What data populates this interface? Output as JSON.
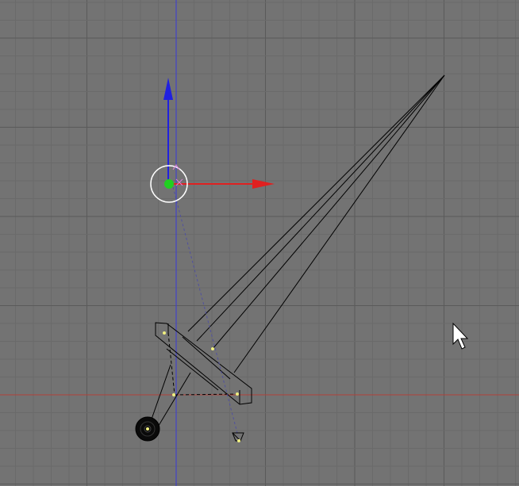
{
  "viewport": {
    "background_color": "#737373",
    "grid_minor_color": "#6a6a6a",
    "grid_major_color": "#5a5a5a",
    "axis_x_color": "#b0403a",
    "axis_z_color": "#3a3ad8",
    "wire_color": "#000000",
    "vertex_color": "#f0f080"
  },
  "gizmo": {
    "x_arrow_color": "#e02020",
    "z_arrow_color": "#2020e0",
    "center_color": "#20d020",
    "ring_color": "#ffffff",
    "marker_color": "#e080e0"
  },
  "cursor": {
    "icon": "mouse-pointer-icon"
  }
}
